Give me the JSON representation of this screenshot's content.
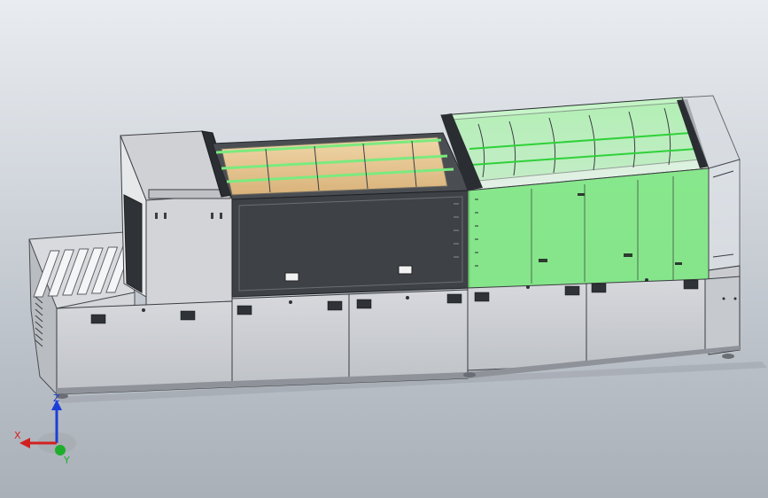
{
  "view": {
    "model_name": "",
    "accent_green": "#7bea7e",
    "frame_dark": "#2a2d31",
    "panel_grey": "#c9cbcf"
  },
  "triad": {
    "x_label": "X",
    "y_label": "Y",
    "z_label": "Z",
    "x_color": "#d22020",
    "y_color": "#1fae2b",
    "z_color": "#1c3fd8",
    "icon": "coordinate-triad-icon"
  }
}
